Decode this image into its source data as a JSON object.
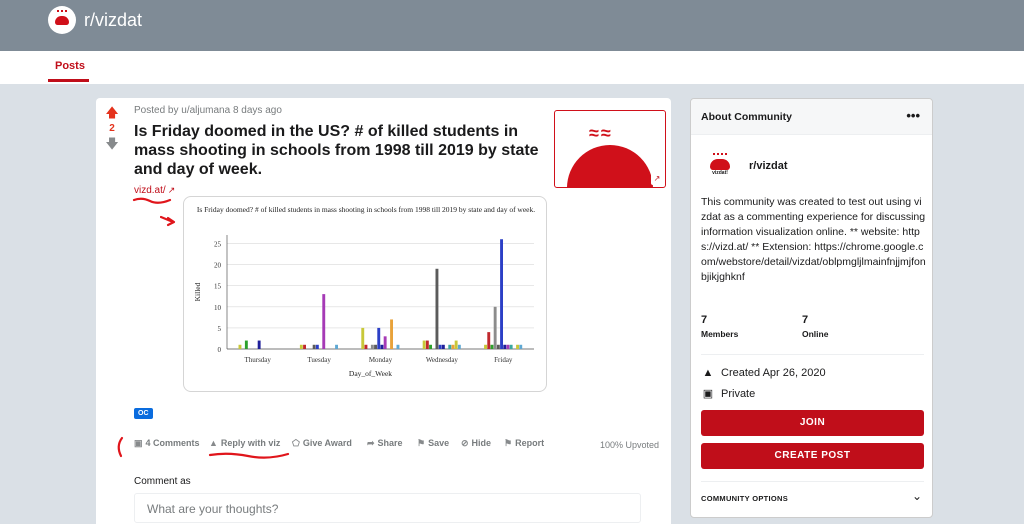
{
  "header": {
    "subreddit": "r/vizdat",
    "logo_icon": "vizdat-logo-icon"
  },
  "nav": {
    "tab_posts": "Posts"
  },
  "post": {
    "vote_count": "2",
    "posted_by": "Posted by u/aljumana 8 days ago",
    "title": "Is Friday doomed in the US? # of killed students in mass shooting in schools from 1998 till 2019 by state and day of week.",
    "link_text": "vizd.at/",
    "flair": "OC",
    "actions": {
      "comments": "4 Comments",
      "reply_viz": "Reply with viz",
      "give_award": "Give Award",
      "share": "Share",
      "save": "Save",
      "hide": "Hide",
      "report": "Report"
    },
    "upvoted": "100% Upvoted",
    "comment_as": "Comment as",
    "comment_placeholder": "What are your thoughts?"
  },
  "chart_data": {
    "type": "bar",
    "title": "Is Friday doomed? # of killed students in mass shooting in schools from 1998 till 2019 by state and day of week.",
    "xlabel": "Day_of_Week",
    "ylabel": "Killed",
    "ylim": [
      0,
      27
    ],
    "yticks": [
      0,
      5,
      10,
      15,
      20,
      25
    ],
    "categories": [
      "Thursday",
      "Tuesday",
      "Monday",
      "Wednesday",
      "Friday"
    ],
    "bar_colors": [
      "#c8c839",
      "#c0282d",
      "#2ca02c",
      "#8c8c8c",
      "#5b5b5b",
      "#2c3fc6",
      "#1f1f9a",
      "#a63ab6",
      "#3aa8a0",
      "#e8a23a",
      "#c8c83a",
      "#5fa8d3"
    ],
    "groups": [
      {
        "category": "Thursday",
        "values": [
          1,
          0,
          2,
          0,
          0,
          0,
          2,
          0,
          0,
          0,
          0,
          0
        ]
      },
      {
        "category": "Tuesday",
        "values": [
          1,
          1,
          0,
          0,
          1,
          1,
          0,
          13,
          0,
          0,
          0,
          1
        ]
      },
      {
        "category": "Monday",
        "values": [
          5,
          1,
          0,
          1,
          1,
          5,
          1,
          3,
          0,
          7,
          0,
          1
        ]
      },
      {
        "category": "Wednesday",
        "values": [
          2,
          2,
          1,
          0,
          19,
          1,
          1,
          0,
          1,
          1,
          2,
          1
        ]
      },
      {
        "category": "Friday",
        "values": [
          1,
          4,
          1,
          10,
          1,
          26,
          1,
          1,
          1,
          0,
          1,
          1
        ]
      }
    ]
  },
  "sidebar": {
    "title": "About Community",
    "more_icon": "more-icon",
    "community_name": "r/vizdat",
    "logo_label": "vizdat!",
    "description": "This community was created to test out using vizdat as a commenting experience for discussing information visualization online. ** website: https://vizd.at/ ** Extension: https://chrome.google.com/webstore/detail/vizdat/oblpmgljlmainfnjjmjfonbjikjghknf",
    "members_count": "7",
    "members_label": "Members",
    "online_count": "7",
    "online_label": "Online",
    "created": "Created Apr 26, 2020",
    "privacy": "Private",
    "join_label": "JOIN",
    "create_post_label": "CREATE POST",
    "options_label": "COMMUNITY OPTIONS"
  },
  "colors": {
    "accent": "#c00e1a",
    "header_bg": "#7f8b96",
    "page_bg": "#dae0e6"
  }
}
